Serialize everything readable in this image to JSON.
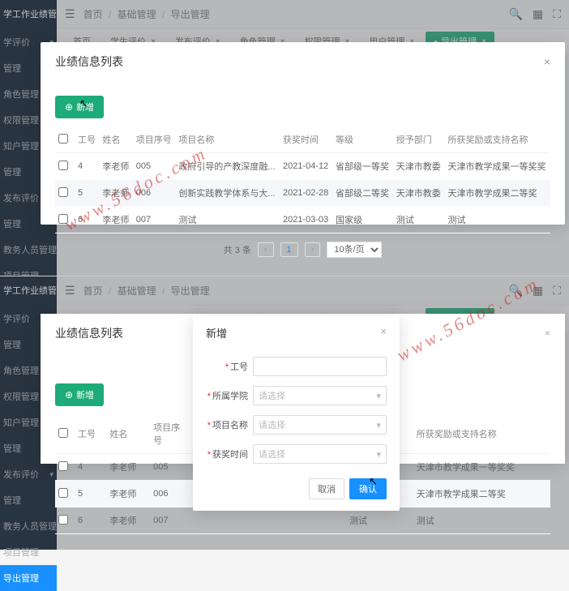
{
  "app_title": "学工作业绩管理系统",
  "breadcrumb": {
    "home": "首页",
    "sep": "/",
    "l1": "基础管理",
    "l2": "导出管理"
  },
  "top_icons": {
    "search": "search-icon",
    "grid": "grid-icon",
    "expand": "expand-icon"
  },
  "tabs": [
    {
      "label": "首页"
    },
    {
      "label": "学生评价"
    },
    {
      "label": "发布评价"
    },
    {
      "label": "角色管理"
    },
    {
      "label": "权限管理"
    },
    {
      "label": "用户管理"
    },
    {
      "label": "导出管理"
    }
  ],
  "sidebar": {
    "groups": [
      {
        "label": "学评价"
      },
      {
        "label": "管理"
      },
      {
        "label": "角色管理"
      },
      {
        "label": "权限管理"
      },
      {
        "label": "知户管理"
      },
      {
        "label": "管理"
      },
      {
        "label": "发布评价"
      },
      {
        "label": "管理"
      },
      {
        "label": "教务人员管理"
      },
      {
        "label": "项目管理"
      },
      {
        "label": "导出管理"
      }
    ]
  },
  "page_title": "业绩信息列表",
  "add_button": "新增",
  "table": {
    "headers": [
      "工号",
      "姓名",
      "项目序号",
      "项目名称",
      "获奖时间",
      "等级",
      "授予部门",
      "所获奖励或支持名称"
    ],
    "rows": [
      {
        "id": "4",
        "name": "李老师",
        "seq": "005",
        "proj": "政府引导的产教深度融...",
        "date": "2021-04-12",
        "level": "省部级一等奖",
        "dept": "天津市教委",
        "award": "天津市教学成果一等奖奖"
      },
      {
        "id": "5",
        "name": "李老师",
        "seq": "006",
        "proj": "创新实践教学体系与大...",
        "date": "2021-02-28",
        "level": "省部级二等奖",
        "dept": "天津市教委",
        "award": "天津市教学成果二等奖"
      },
      {
        "id": "6",
        "name": "李老师",
        "seq": "007",
        "proj": "测试",
        "date": "2021-03-03",
        "level": "国家级",
        "dept": "测试",
        "award": "测试"
      }
    ]
  },
  "pagination": {
    "total": "共 3 条",
    "prev": "‹",
    "current": "1",
    "next": "›",
    "size": "10条/页"
  },
  "form_modal": {
    "title": "新增",
    "fields": {
      "gh": "工号",
      "college": "所属学院",
      "proj": "项目名称",
      "date": "获奖时间"
    },
    "placeholder": "请选择",
    "cancel": "取消",
    "ok": "确认"
  },
  "watermark": "www.56doc.com"
}
